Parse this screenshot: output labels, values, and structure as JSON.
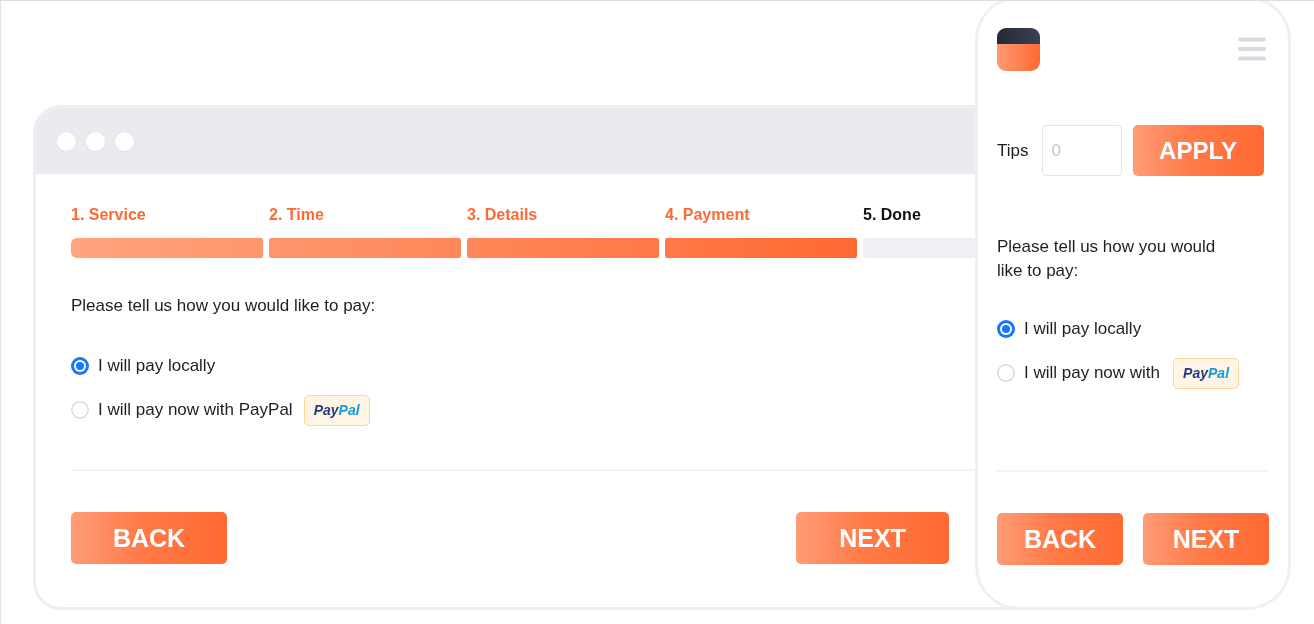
{
  "desktop": {
    "steps": [
      {
        "label": "1. Service",
        "completed": true
      },
      {
        "label": "2. Time",
        "completed": true
      },
      {
        "label": "3. Details",
        "completed": true
      },
      {
        "label": "4. Payment",
        "completed": true
      },
      {
        "label": "5. Done",
        "completed": false
      }
    ],
    "prompt": "Please tell us how you would like to pay:",
    "options": [
      {
        "label": "I will pay locally",
        "selected": true
      },
      {
        "label": "I will pay now with PayPal",
        "selected": false,
        "badge": [
          {
            "text": "Pay",
            "color": "#253b80"
          },
          {
            "text": "Pal",
            "color": "#179bd7"
          }
        ]
      }
    ],
    "buttons": [
      "BACK",
      "NEXT"
    ]
  },
  "phone": {
    "tips": {
      "label": "Tips",
      "placeholder": "0"
    },
    "apply_button": "APPLY",
    "prompt": "Please tell us how you would like to pay:",
    "options": [
      {
        "label": "I will pay locally",
        "selected": true
      },
      {
        "label": "I will pay now with",
        "selected": false,
        "badge": [
          {
            "text": "Pay",
            "color": "#253b80"
          },
          {
            "text": "Pal",
            "color": "#179bd7"
          }
        ]
      }
    ],
    "buttons": [
      "BACK",
      "NEXT"
    ]
  }
}
